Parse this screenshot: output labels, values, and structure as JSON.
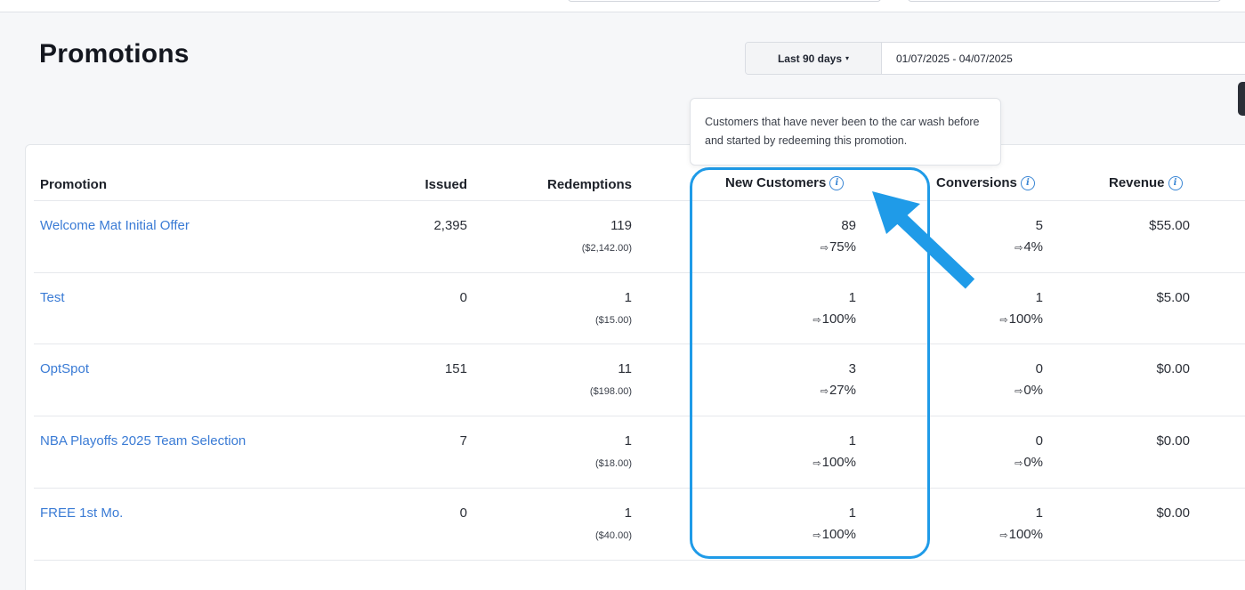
{
  "page_title": "Promotions",
  "date_filter": {
    "preset_label": "Last 90 days",
    "range_value": "01/07/2025 - 04/07/2025"
  },
  "tooltip_text": "Customers that have never been to the car wash before and started by redeeming this promotion.",
  "columns": {
    "promotion": "Promotion",
    "issued": "Issued",
    "redemptions": "Redemptions",
    "new_customers": "New Customers",
    "conversions": "Conversions",
    "revenue": "Revenue"
  },
  "rows": [
    {
      "name": "Welcome Mat Initial Offer",
      "issued": "2,395",
      "redemptions": "119",
      "redemptions_value": "($2,142.00)",
      "new_customers": "89",
      "new_customers_pct": "75%",
      "conversions": "5",
      "conversions_pct": "4%",
      "revenue": "$55.00"
    },
    {
      "name": "Test",
      "issued": "0",
      "redemptions": "1",
      "redemptions_value": "($15.00)",
      "new_customers": "1",
      "new_customers_pct": "100%",
      "conversions": "1",
      "conversions_pct": "100%",
      "revenue": "$5.00"
    },
    {
      "name": "OptSpot",
      "issued": "151",
      "redemptions": "11",
      "redemptions_value": "($198.00)",
      "new_customers": "3",
      "new_customers_pct": "27%",
      "conversions": "0",
      "conversions_pct": "0%",
      "revenue": "$0.00"
    },
    {
      "name": "NBA Playoffs 2025 Team Selection",
      "issued": "7",
      "redemptions": "1",
      "redemptions_value": "($18.00)",
      "new_customers": "1",
      "new_customers_pct": "100%",
      "conversions": "0",
      "conversions_pct": "0%",
      "revenue": "$0.00"
    },
    {
      "name": "FREE 1st Mo.",
      "issued": "0",
      "redemptions": "1",
      "redemptions_value": "($40.00)",
      "new_customers": "1",
      "new_customers_pct": "100%",
      "conversions": "1",
      "conversions_pct": "100%",
      "revenue": "$0.00"
    }
  ],
  "icons": {
    "info": "info-icon",
    "pct_arrow": "arrow-right-icon",
    "caret": "caret-down-icon"
  },
  "colors": {
    "link": "#3a7bd5",
    "annotation": "#1f9be8"
  }
}
